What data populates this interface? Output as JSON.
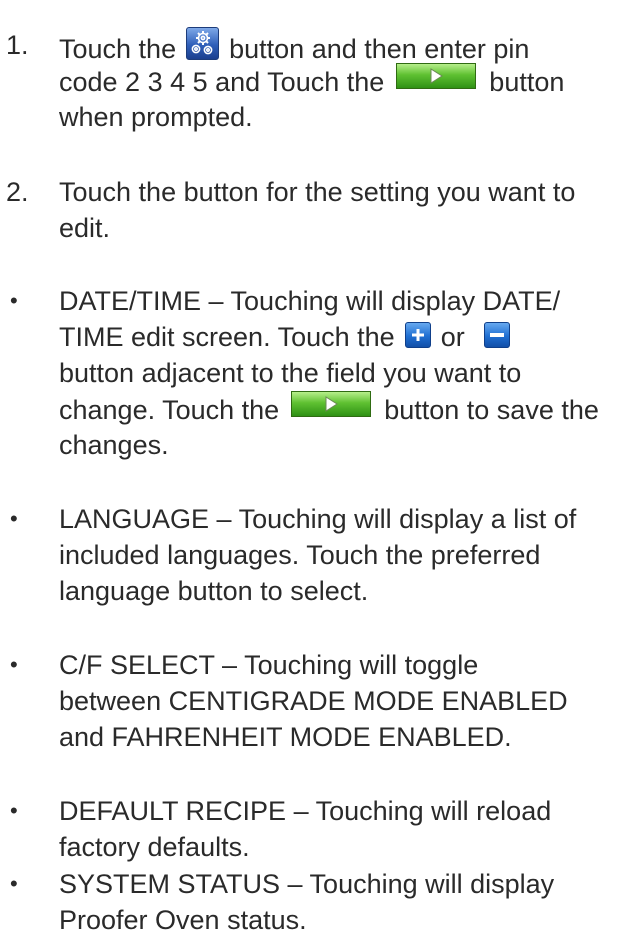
{
  "steps": [
    {
      "number": "1.",
      "line1_a": "Touch the",
      "line1_b": "button and then enter pin",
      "line2_a": "code 2 3 4 5 and Touch the",
      "line2_b": "button",
      "line3": "when prompted."
    },
    {
      "number": "2.",
      "line1": "Touch the button for the setting you want to",
      "line2": "edit."
    }
  ],
  "bullets": [
    {
      "marker": "•",
      "line1": "DATE/TIME – Touching will display DATE/",
      "line2_a": "TIME edit screen.  Touch the",
      "line2_b": "or",
      "line3": "button adjacent to the field you want to",
      "line4_a": "change. Touch the",
      "line4_b": "button to save the",
      "line5": "changes."
    },
    {
      "marker": "•",
      "line1": "LANGUAGE – Touching will display a list of",
      "line2": "included languages.  Touch the preferred",
      "line3": "language button to select."
    },
    {
      "marker": "•",
      "line1": "C/F SELECT – Touching will toggle",
      "line2": "between CENTIGRADE MODE ENABLED",
      "line3": "and FAHRENHEIT MODE ENABLED."
    },
    {
      "marker": "•",
      "line1": "DEFAULT RECIPE – Touching will reload",
      "line2": "factory defaults."
    },
    {
      "marker": "•",
      "line1": "SYSTEM STATUS – Touching will display",
      "line2": "Proofer Oven status."
    }
  ],
  "icons": {
    "settings": "gear-icon",
    "next": "play-arrow-icon",
    "plus": "plus-icon",
    "minus": "minus-icon"
  },
  "colors": {
    "text": "#2a2a2a",
    "settings_button": "#2f5fb9",
    "next_button": "#5fc132",
    "plus_minus_button": "#1f6fd2"
  }
}
